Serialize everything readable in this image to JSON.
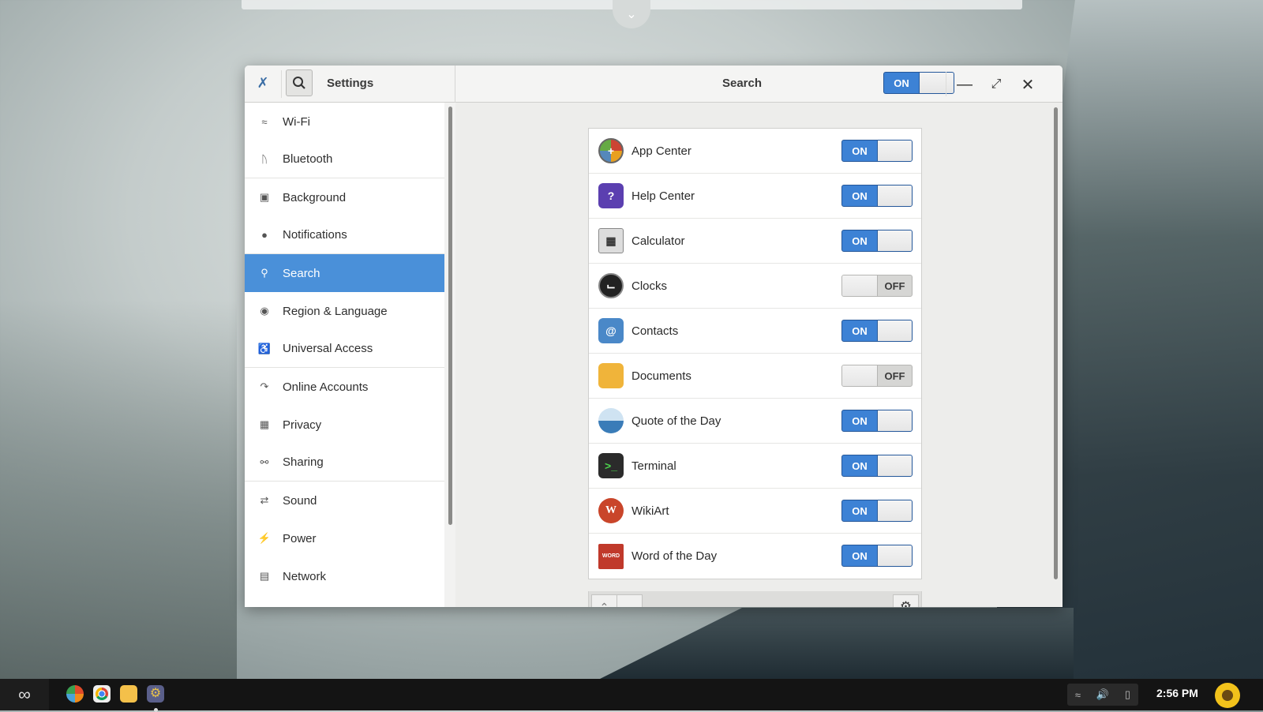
{
  "window": {
    "app_title": "Settings",
    "page_title": "Search",
    "master_switch": {
      "state": "on",
      "label": "ON"
    }
  },
  "sidebar": {
    "items": [
      {
        "label": "Wi-Fi",
        "icon": "wifi-icon"
      },
      {
        "label": "Bluetooth",
        "icon": "bluetooth-icon"
      },
      {
        "label": "Background",
        "icon": "background-icon"
      },
      {
        "label": "Notifications",
        "icon": "notifications-icon"
      },
      {
        "label": "Search",
        "icon": "search-icon",
        "active": true
      },
      {
        "label": "Region & Language",
        "icon": "region-icon"
      },
      {
        "label": "Universal Access",
        "icon": "accessibility-icon"
      },
      {
        "label": "Online Accounts",
        "icon": "online-accounts-icon"
      },
      {
        "label": "Privacy",
        "icon": "privacy-icon"
      },
      {
        "label": "Sharing",
        "icon": "sharing-icon"
      },
      {
        "label": "Sound",
        "icon": "sound-icon"
      },
      {
        "label": "Power",
        "icon": "power-icon"
      },
      {
        "label": "Network",
        "icon": "network-icon"
      }
    ]
  },
  "search_providers": [
    {
      "name": "App Center",
      "state": "ON"
    },
    {
      "name": "Help Center",
      "state": "ON"
    },
    {
      "name": "Calculator",
      "state": "ON"
    },
    {
      "name": "Clocks",
      "state": "OFF"
    },
    {
      "name": "Contacts",
      "state": "ON"
    },
    {
      "name": "Documents",
      "state": "OFF"
    },
    {
      "name": "Quote of the Day",
      "state": "ON"
    },
    {
      "name": "Terminal",
      "state": "ON"
    },
    {
      "name": "WikiArt",
      "state": "ON"
    },
    {
      "name": "Word of the Day",
      "state": "ON"
    }
  ],
  "taskbar": {
    "clock": "2:56 PM"
  },
  "colors": {
    "accent": "#4a90d9",
    "switch_on": "#3d82d5"
  }
}
